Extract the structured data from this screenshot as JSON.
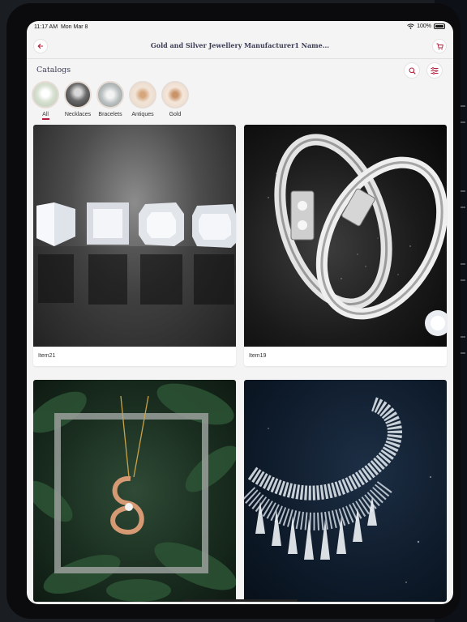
{
  "status_bar": {
    "time": "11:17 AM",
    "date": "Mon Mar 8",
    "battery": "100%"
  },
  "header": {
    "title": "Gold and Silver Jewellery Manufacturer1 Name..."
  },
  "catalogs": {
    "title": "Catalogs",
    "items": [
      {
        "label": "All",
        "active": true
      },
      {
        "label": "Necklaces",
        "active": false
      },
      {
        "label": "Bracelets",
        "active": false
      },
      {
        "label": "Antiques",
        "active": false
      },
      {
        "label": "Gold",
        "active": false
      }
    ]
  },
  "products": [
    {
      "name": "Item21",
      "image": "diamonds"
    },
    {
      "name": "Item19",
      "image": "silver-rings"
    },
    {
      "name": "",
      "image": "gold-pendant"
    },
    {
      "name": "",
      "image": "diamond-necklace"
    }
  ],
  "icons": [
    "back-arrow-icon",
    "cart-icon",
    "search-icon",
    "filter-icon",
    "wifi-icon",
    "battery-icon"
  ],
  "colors": {
    "accent": "#b21e3a",
    "title": "#3a3c55",
    "background": "#f5f4f4"
  }
}
